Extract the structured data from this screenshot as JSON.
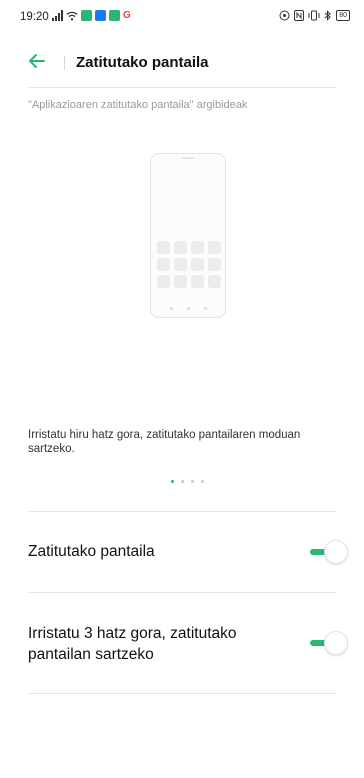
{
  "status_bar": {
    "time": "19:20",
    "battery": "80",
    "app_icons": [
      {
        "name": "chat-app-icon",
        "color": "#2bb673"
      },
      {
        "name": "facebook-icon",
        "color": "#1877f2"
      },
      {
        "name": "message-app-icon",
        "color": "#2bb673"
      },
      {
        "name": "google-icon",
        "color": "#ea4335"
      }
    ],
    "right_icons": [
      "sync-icon",
      "nfc-icon",
      "vibrate-icon",
      "bluetooth-icon"
    ]
  },
  "header": {
    "title": "Zatitutako pantaila",
    "back_icon": "back-arrow-icon",
    "accent": "#2bb673"
  },
  "tips": {
    "section_label": "\"Aplikazioaren zatitutako pantaila\" argibideak",
    "illustration": "phone-illustration",
    "description": "Irristatu hiru hatz gora, zatitutako pantailaren moduan sartzeko.",
    "pager": {
      "total": 4,
      "current": 1
    }
  },
  "settings": [
    {
      "label": "Zatitutako pantaila",
      "enabled": true
    },
    {
      "label": "Irristatu 3 hatz gora, zatitutako pantailan sartzeko",
      "enabled": true
    }
  ]
}
